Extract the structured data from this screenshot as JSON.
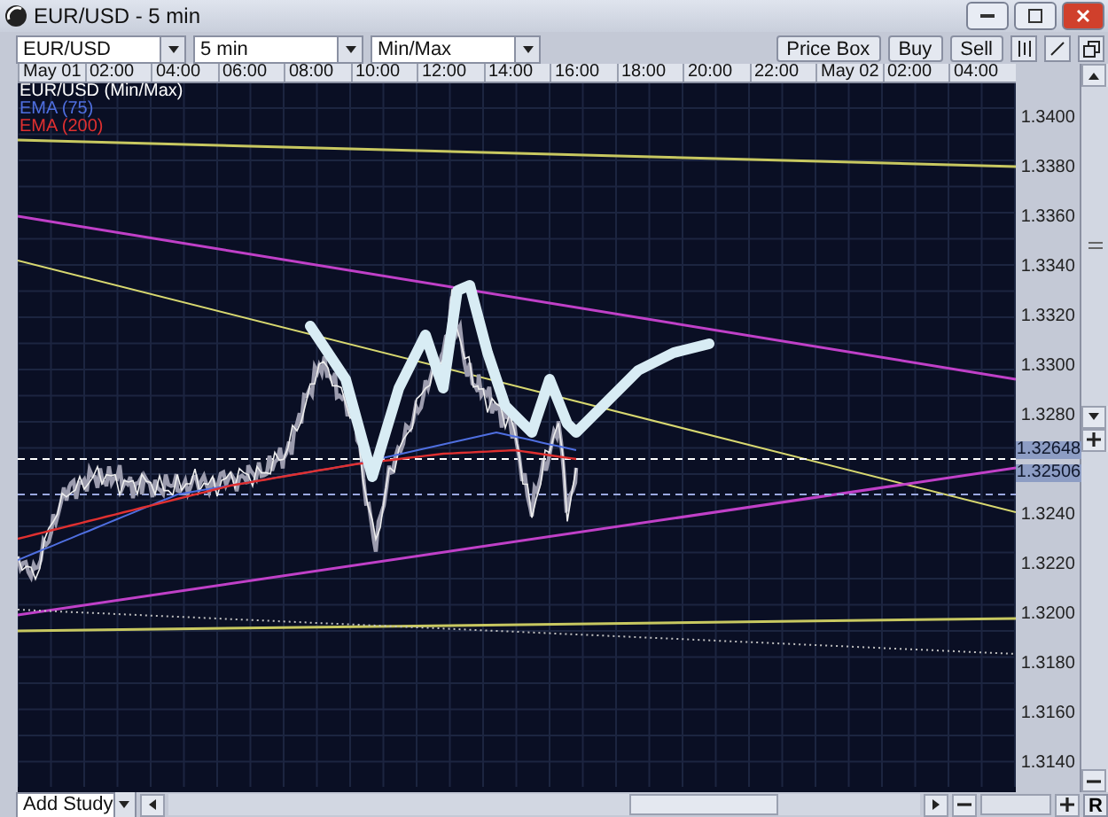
{
  "window": {
    "title": "EUR/USD - 5 min"
  },
  "toolbar": {
    "dropdowns": [
      "EUR/USD",
      "5 min",
      "Min/Max"
    ],
    "buttons": [
      "Price Box",
      "Buy",
      "Sell"
    ]
  },
  "time_axis": [
    "May 01",
    "02:00",
    "04:00",
    "06:00",
    "08:00",
    "10:00",
    "12:00",
    "14:00",
    "16:00",
    "18:00",
    "20:00",
    "22:00",
    "May 02",
    "02:00",
    "04:00"
  ],
  "legend": [
    {
      "label": "EUR/USD (Min/Max)",
      "color": "#ffffff"
    },
    {
      "label": "EMA (75)",
      "color": "#4f6fe0"
    },
    {
      "label": "EMA (200)",
      "color": "#e03030"
    }
  ],
  "price_axis_upper": [
    "1.3400",
    "1.3380",
    "1.3360",
    "1.3340",
    "1.3320",
    "1.3300",
    "1.3280"
  ],
  "price_axis_lower": [
    "1.3240",
    "1.3220",
    "1.3200",
    "1.3180",
    "1.3160",
    "1.3140"
  ],
  "price_markers": [
    "1.32648",
    "1.32506"
  ],
  "bottom_bar": {
    "study_dropdown": "Add Study",
    "reset": "R"
  }
}
